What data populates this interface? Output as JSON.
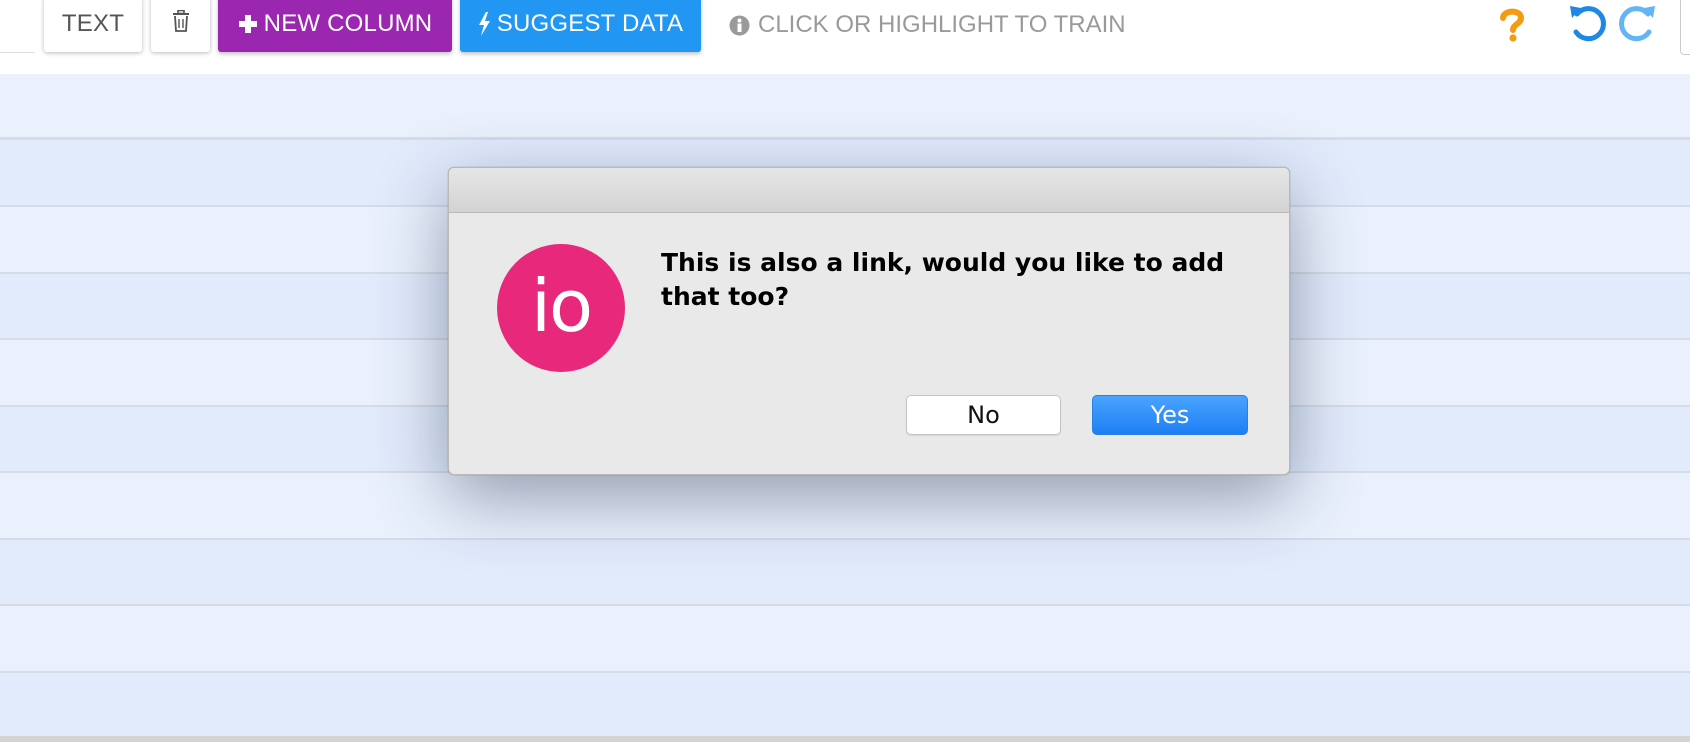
{
  "toolbar": {
    "text_button_label": "TEXT",
    "delete_icon": "trash-icon",
    "new_column_label": "NEW COLUMN",
    "new_column_icon": "plus-icon",
    "suggest_data_label": "SUGGEST DATA",
    "suggest_data_icon": "bolt-icon",
    "hint_text": "CLICK OR HIGHLIGHT TO TRAIN",
    "hint_icon": "info-icon",
    "help_icon": "question-mark-icon",
    "undo_icon": "undo-icon",
    "redo_icon": "redo-icon"
  },
  "dialog": {
    "logo_text": "io",
    "message": "This is also a link, would you like to add that too?",
    "no_label": "No",
    "yes_label": "Yes"
  },
  "colors": {
    "new_column_button": "#9b27b0",
    "suggest_data_button": "#2196f3",
    "help_icon": "#f39c12",
    "undo_icon": "#1e88e5",
    "redo_icon": "#64b5f6",
    "logo": "#e8287a",
    "yes_button": "#1d7ff5",
    "table_row_light": "#eaf1fd",
    "table_row_dark": "#e1ebfc"
  }
}
